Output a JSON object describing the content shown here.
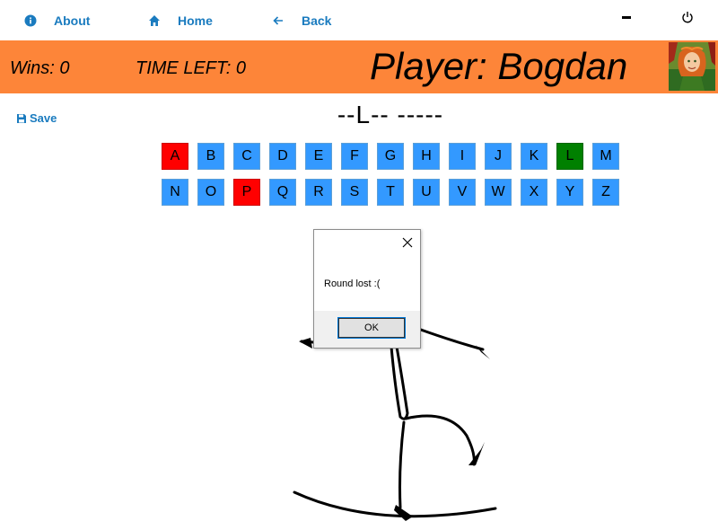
{
  "nav": {
    "about_label": "About",
    "home_label": "Home",
    "back_label": "Back"
  },
  "banner": {
    "wins": "Wins: 0",
    "time_left": "TIME LEFT: 0",
    "player": "Player: Bogdan"
  },
  "save_label": "Save",
  "word": "--L-- -----",
  "letters": [
    {
      "char": "A",
      "state": "wrong"
    },
    {
      "char": "B",
      "state": "unused"
    },
    {
      "char": "C",
      "state": "unused"
    },
    {
      "char": "D",
      "state": "unused"
    },
    {
      "char": "E",
      "state": "unused"
    },
    {
      "char": "F",
      "state": "unused"
    },
    {
      "char": "G",
      "state": "unused"
    },
    {
      "char": "H",
      "state": "unused"
    },
    {
      "char": "I",
      "state": "unused"
    },
    {
      "char": "J",
      "state": "unused"
    },
    {
      "char": "K",
      "state": "unused"
    },
    {
      "char": "L",
      "state": "right"
    },
    {
      "char": "M",
      "state": "unused"
    },
    {
      "char": "N",
      "state": "unused"
    },
    {
      "char": "O",
      "state": "unused"
    },
    {
      "char": "P",
      "state": "wrong"
    },
    {
      "char": "Q",
      "state": "unused"
    },
    {
      "char": "R",
      "state": "unused"
    },
    {
      "char": "S",
      "state": "unused"
    },
    {
      "char": "T",
      "state": "unused"
    },
    {
      "char": "U",
      "state": "unused"
    },
    {
      "char": "V",
      "state": "unused"
    },
    {
      "char": "W",
      "state": "unused"
    },
    {
      "char": "X",
      "state": "unused"
    },
    {
      "char": "Y",
      "state": "unused"
    },
    {
      "char": "Z",
      "state": "unused"
    }
  ],
  "dialog": {
    "message": "Round lost :(",
    "ok_label": "OK"
  },
  "colors": {
    "accent": "#1a7bbf",
    "banner": "#fd8539",
    "letter_default": "#3399ff",
    "letter_wrong": "#ff0000",
    "letter_right": "#008000"
  }
}
